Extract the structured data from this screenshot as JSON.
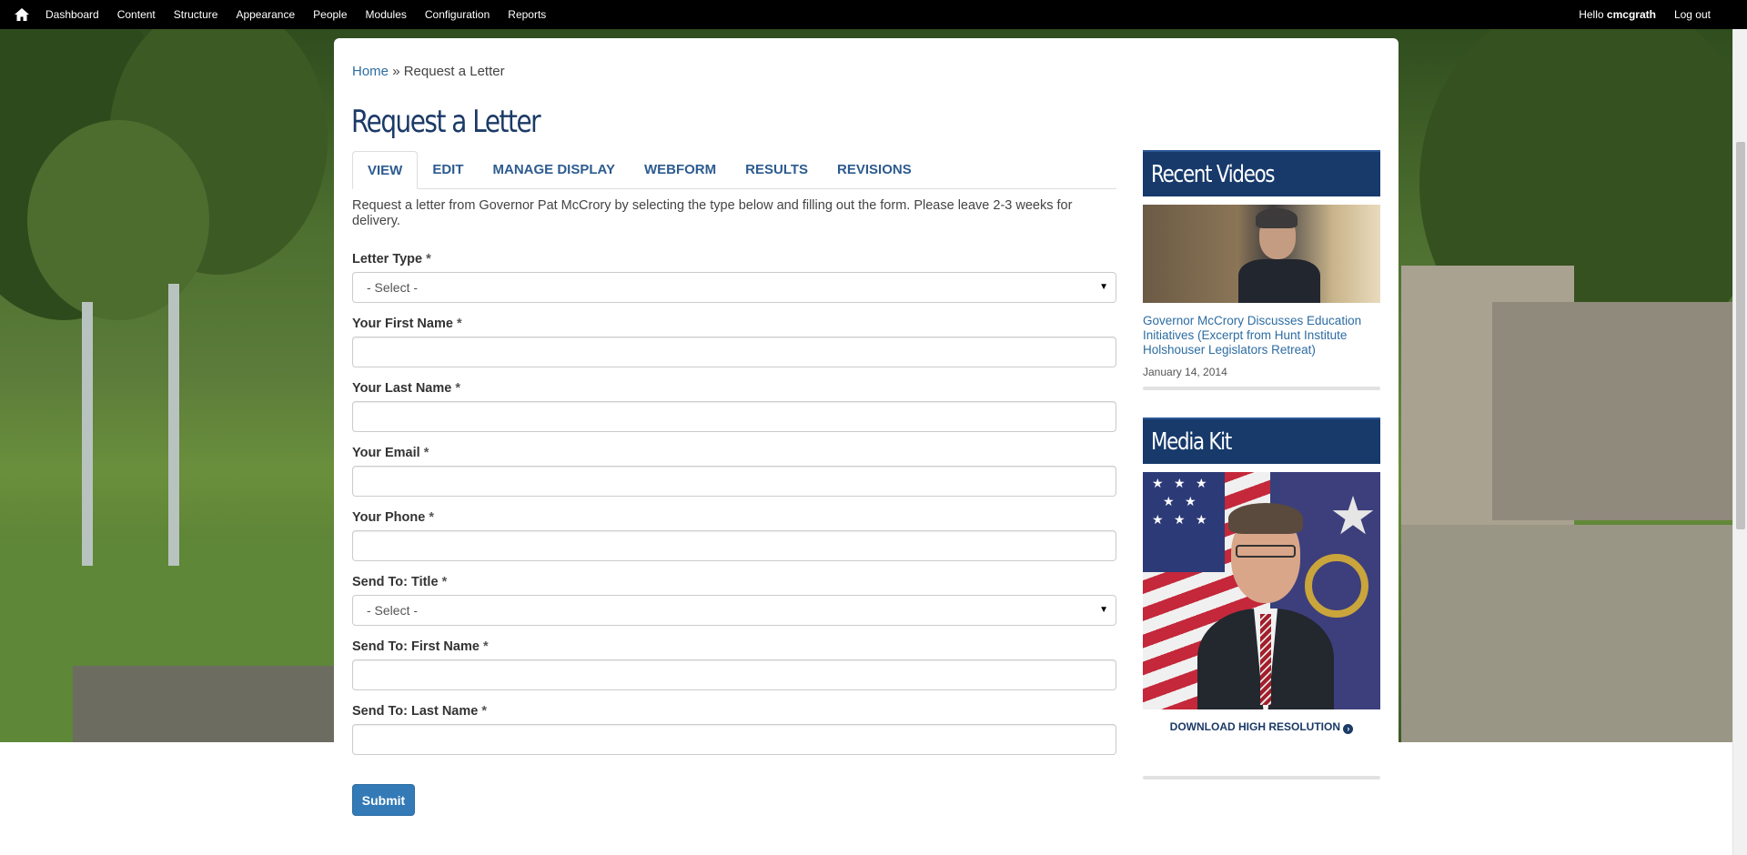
{
  "toolbar": {
    "home_icon": "home-icon",
    "menu": [
      "Dashboard",
      "Content",
      "Structure",
      "Appearance",
      "People",
      "Modules",
      "Configuration",
      "Reports"
    ],
    "hello_prefix": "Hello",
    "username": "cmcgrath",
    "logout": "Log out"
  },
  "breadcrumb": {
    "home": "Home",
    "separator": "»",
    "current": "Request a Letter"
  },
  "page": {
    "title": "Request a Letter",
    "tabs": [
      "VIEW",
      "EDIT",
      "MANAGE DISPLAY",
      "WEBFORM",
      "RESULTS",
      "REVISIONS"
    ],
    "active_tab": "VIEW",
    "intro": "Request a letter from Governor Pat McCrory by selecting the type below and filling out the form. Please leave 2-3 weeks for delivery."
  },
  "form": {
    "required_marker": "*",
    "fields": [
      {
        "label": "Letter Type",
        "type": "select",
        "value": "- Select -"
      },
      {
        "label": "Your First Name",
        "type": "text",
        "value": ""
      },
      {
        "label": "Your Last Name",
        "type": "text",
        "value": ""
      },
      {
        "label": "Your Email",
        "type": "text",
        "value": ""
      },
      {
        "label": "Your Phone",
        "type": "text",
        "value": ""
      },
      {
        "label": "Send To: Title",
        "type": "select",
        "value": "- Select -"
      },
      {
        "label": "Send To: First Name",
        "type": "text",
        "value": ""
      },
      {
        "label": "Send To: Last Name",
        "type": "text",
        "value": ""
      }
    ],
    "submit": "Submit"
  },
  "sidebar": {
    "recent_videos": {
      "title": "Recent Videos",
      "video_title": "Governor McCrory Discusses Education Initiatives (Excerpt from Hunt Institute Holshouser Legislators Retreat)",
      "date": "January 14, 2014"
    },
    "media_kit": {
      "title": "Media Kit",
      "download": "DOWNLOAD HIGH RESOLUTION",
      "download_icon": "chevron-circle-right-icon"
    }
  },
  "colors": {
    "toolbar_bg": "#000000",
    "title_blue": "#1b3a66",
    "link_blue": "#2d6ca2",
    "block_header_bg": "#173a6b",
    "button_blue": "#337ab7"
  }
}
